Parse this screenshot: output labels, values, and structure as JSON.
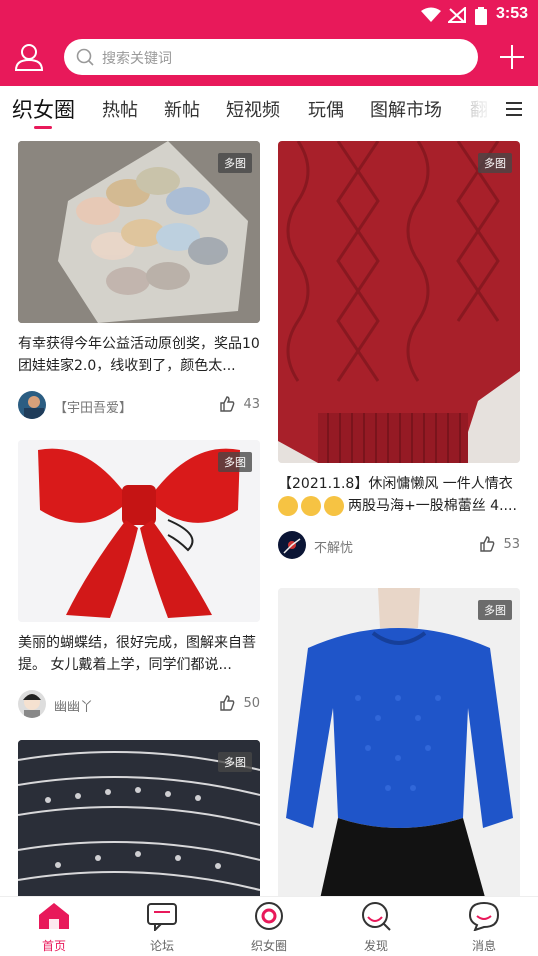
{
  "status": {
    "time": "3:53"
  },
  "search": {
    "placeholder": "搜索关键词"
  },
  "tabs": [
    {
      "label": "织女圈"
    },
    {
      "label": "热帖"
    },
    {
      "label": "新帖"
    },
    {
      "label": "短视频"
    },
    {
      "label": "玩偶"
    },
    {
      "label": "图解市场"
    },
    {
      "label": "翻"
    }
  ],
  "feed": {
    "left": [
      {
        "badge": "多图",
        "title": "有幸获得今年公益活动原创奖，奖品10团娃娃家2.0，线收到了，颜色太...",
        "user": "【宇田吾爱】",
        "likes": "43"
      },
      {
        "badge": "多图",
        "title": "美丽的蝴蝶结，很好完成，图解来自菩提。 女儿戴着上学，同学们都说...",
        "user": "幽幽丫",
        "likes": "50"
      },
      {
        "badge": "多图"
      }
    ],
    "right": [
      {
        "badge": "多图",
        "title": "【2021.1.8】休闲慵懒风 一件人情衣",
        "title2": "两股马海+一股棉蕾丝 4....",
        "user": "不解忧",
        "likes": "53"
      },
      {
        "badge": "多图"
      }
    ]
  },
  "nav": [
    {
      "label": "首页"
    },
    {
      "label": "论坛"
    },
    {
      "label": "织女圈"
    },
    {
      "label": "发现"
    },
    {
      "label": "消息"
    }
  ],
  "colors": {
    "brand": "#e8195a"
  }
}
